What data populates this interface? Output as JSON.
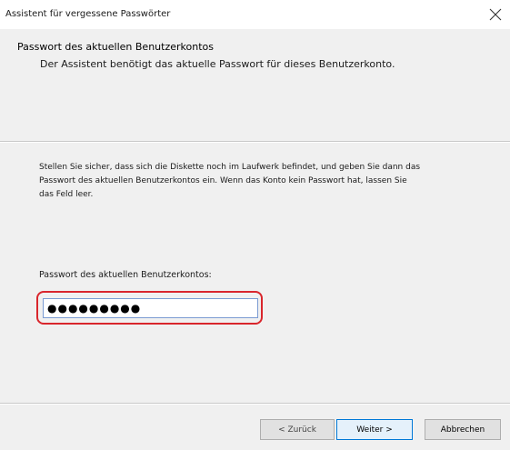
{
  "window": {
    "title": "Assistent für vergessene Passwörter",
    "close_icon": "close-icon"
  },
  "header": {
    "title": "Passwort des aktuellen Benutzerkontos",
    "subtitle": "Der Assistent benötigt das aktuelle Passwort für dieses Benutzerkonto."
  },
  "content": {
    "instructions": "Stellen Sie sicher, dass sich die Diskette noch im Laufwerk befindet, und geben Sie dann das Passwort des aktuellen Benutzerkontos ein. Wenn das Konto kein Passwort hat, lassen Sie das Feld leer.",
    "password_label": "Passwort des aktuellen Benutzerkontos:",
    "password_value": "●●●●●●●●●"
  },
  "buttons": {
    "back": "< Zurück",
    "next": "Weiter >",
    "cancel": "Abbrechen"
  },
  "colors": {
    "highlight": "#d9262c",
    "focus_border": "#0078d7",
    "background": "#f0f0f0"
  }
}
